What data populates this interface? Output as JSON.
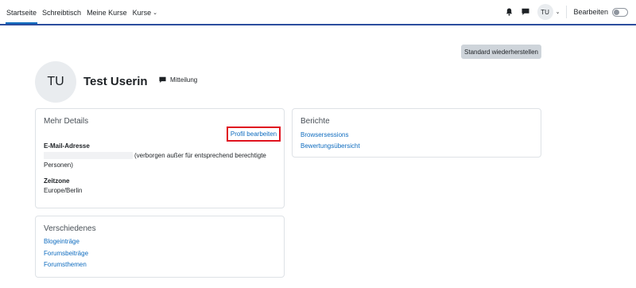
{
  "nav": {
    "items": [
      {
        "label": "Startseite",
        "active": true
      },
      {
        "label": "Schreibtisch",
        "active": false
      },
      {
        "label": "Meine Kurse",
        "active": false
      },
      {
        "label": "Kurse",
        "active": false,
        "has_dropdown": true
      }
    ],
    "user_initials": "TU",
    "edit_mode_label": "Bearbeiten",
    "edit_mode_on": false,
    "icons": [
      "bell-icon",
      "chat-icon"
    ]
  },
  "reset_button_label": "Standard wiederherstellen",
  "profile": {
    "initials": "TU",
    "name": "Test Userin",
    "message_label": "Mitteilung"
  },
  "details_card": {
    "title": "Mehr Details",
    "edit_profile_label": "Profil bearbeiten",
    "email_label": "E-Mail-Adresse",
    "email_note_line1": "(verborgen außer für entsprechend berechtigte",
    "email_note_line2": "Personen)",
    "timezone_label": "Zeitzone",
    "timezone_value": "Europe/Berlin"
  },
  "reports_card": {
    "title": "Berichte",
    "links": [
      "Browsersessions",
      "Bewertungsübersicht"
    ]
  },
  "misc_card": {
    "title": "Verschiedenes",
    "links": [
      "Blogeinträge",
      "Forumsbeiträge",
      "Forumsthemen"
    ]
  },
  "colors": {
    "accent": "#0f6cbf",
    "nav_border": "#2c4d9e",
    "highlight_border": "#e0131f"
  }
}
